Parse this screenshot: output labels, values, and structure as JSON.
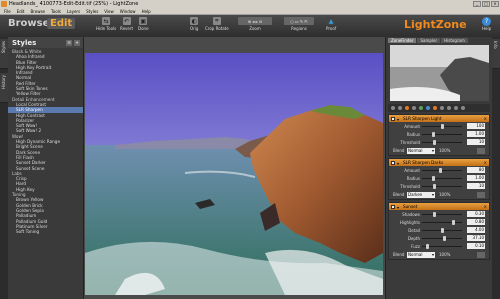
{
  "window": {
    "title": "Headlands_ 4100773-Edit-Edit.tif (25%) - LightZone",
    "controls": [
      "_",
      "□",
      "×"
    ]
  },
  "menu": [
    "File",
    "Edit",
    "Browse",
    "Tools",
    "Layers",
    "Styles",
    "View",
    "Window",
    "Help"
  ],
  "toolbar": {
    "browse_label": "Browse",
    "edit_label": "Edit",
    "tools": [
      {
        "label": "Hide Tools",
        "icon": "hide-tools-icon"
      },
      {
        "label": "Revert",
        "icon": "revert-icon"
      },
      {
        "label": "Done",
        "icon": "done-icon"
      },
      {
        "label": "Orig",
        "icon": "original-icon"
      },
      {
        "label": "Crop Rotate",
        "icon": "crop-rotate-icon"
      },
      {
        "label": "Zoom",
        "icon": "zoom-icon"
      },
      {
        "label": "Regions",
        "icon": "regions-icon"
      },
      {
        "label": "Proof",
        "icon": "proof-icon"
      }
    ],
    "logo": "LightZone",
    "help_label": "Help"
  },
  "side_tabs": [
    "Styles",
    "History"
  ],
  "right_side_tabs": [
    "Info"
  ],
  "styles_panel": {
    "title": "Styles",
    "items": [
      "Black & White",
      "Ahoa Infrared",
      "Blue Filter",
      "High Key Portrait",
      "Infrared",
      "Normal",
      "Red Filter",
      "Soft Skin Tones",
      "Yellow Filter",
      "Detail Enhancement",
      "Local Contrast",
      "SLR Sharpen",
      "High Contrast",
      "Polarizer",
      "Soft Wow!",
      "Soft Wow! 2",
      "Wow!",
      "High Dynamic Range",
      "Bright Scene",
      "Dark Scene",
      "Fill Flash",
      "Sunset Darker",
      "Sunset Scene",
      "Labs",
      "Crisp",
      "Hard",
      "High Key",
      "Toning",
      "Brown Yellow",
      "Golden Brick",
      "Golden Sepia",
      "Palladium",
      "Palladium Gold",
      "Platinum Silver",
      "Soft Toning"
    ],
    "groups": [
      0,
      9,
      16,
      23,
      27
    ],
    "selected_index": 11
  },
  "navigator": {
    "tabs": [
      "ZoneFinder",
      "Sampler",
      "Histogram"
    ],
    "active": 0
  },
  "tools_panels": [
    {
      "title": "SLR Sharpen Light",
      "sliders": [
        {
          "label": "Amount",
          "value": "100",
          "level": 0.5
        },
        {
          "label": "Radius",
          "value": "1.00",
          "level": 0.25
        },
        {
          "label": "Threshold",
          "value": "10",
          "level": 0.3
        }
      ],
      "blend": {
        "label": "Blend",
        "mode": "Normal",
        "opacity": "100%"
      }
    },
    {
      "title": "SLR Sharpen Darks",
      "sliders": [
        {
          "label": "Amount",
          "value": "80",
          "level": 0.45
        },
        {
          "label": "Radius",
          "value": "1.00",
          "level": 0.25
        },
        {
          "label": "Threshold",
          "value": "10",
          "level": 0.3
        }
      ],
      "blend": {
        "label": "Blend",
        "mode": "Darken",
        "opacity": "100%"
      }
    },
    {
      "title": "Sunset",
      "sliders": [
        {
          "label": "Shadows",
          "value": "0.30",
          "level": 0.3
        },
        {
          "label": "Highlights",
          "value": "0.80",
          "level": 0.8
        },
        {
          "label": "Detail",
          "value": "4.00",
          "level": 0.5
        },
        {
          "label": "Depth",
          "value": "37.10",
          "level": 0.55
        },
        {
          "label": "Fuzz",
          "value": "0.10",
          "level": 0.1
        }
      ],
      "blend": {
        "label": "Blend",
        "mode": "Normal",
        "opacity": "100%"
      }
    }
  ]
}
